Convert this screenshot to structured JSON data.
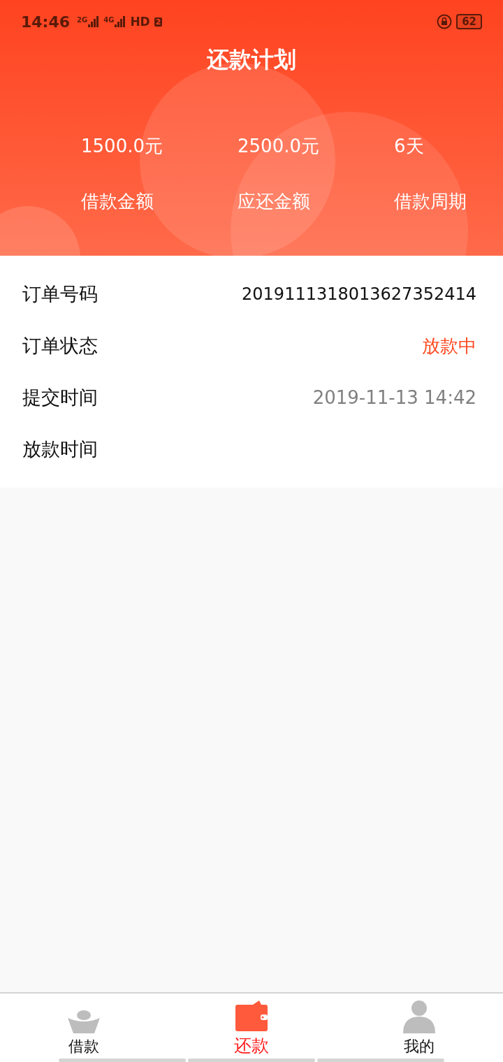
{
  "status_bar": {
    "time": "14:46",
    "sims": [
      {
        "network": "2G"
      },
      {
        "network": "4G"
      }
    ],
    "hd": "HD",
    "hd_slot": "2",
    "battery": "62"
  },
  "title": "还款计划",
  "summary": [
    {
      "value": "1500.0元",
      "label": "借款金额"
    },
    {
      "value": "2500.0元",
      "label": "应还金额"
    },
    {
      "value": "6天",
      "label": "借款周期"
    }
  ],
  "details": [
    {
      "label": "订单号码",
      "value": "2019111318013627352414",
      "kind": "plain"
    },
    {
      "label": "订单状态",
      "value": "放款中",
      "kind": "status"
    },
    {
      "label": "提交时间",
      "value": "2019-11-13 14:42",
      "kind": "muted"
    },
    {
      "label": "放款时间"
    }
  ],
  "tabs": [
    {
      "label": "借款",
      "kind": "ingot",
      "selected": false
    },
    {
      "label": "还款",
      "kind": "wallet",
      "selected": true
    },
    {
      "label": "我的",
      "kind": "person",
      "selected": false
    }
  ]
}
